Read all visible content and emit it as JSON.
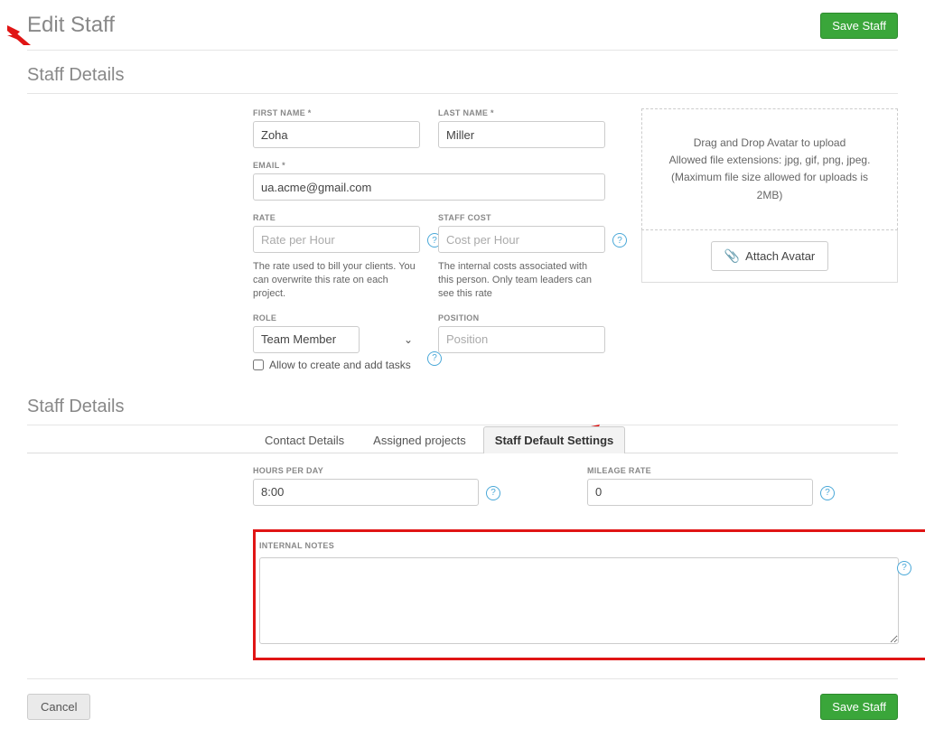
{
  "header": {
    "title": "Edit Staff",
    "save_label": "Save Staff"
  },
  "section1": {
    "title": "Staff Details",
    "first_name_label": "FIRST NAME *",
    "first_name_value": "Zoha",
    "last_name_label": "LAST NAME *",
    "last_name_value": "Miller",
    "email_label": "EMAIL *",
    "email_value": "ua.acme@gmail.com",
    "rate_label": "RATE",
    "rate_placeholder": "Rate per Hour",
    "rate_hint": "The rate used to bill your clients. You can overwrite this rate on each project.",
    "staff_cost_label": "STAFF COST",
    "staff_cost_placeholder": "Cost per Hour",
    "staff_cost_hint": "The internal costs associated with this person. Only team leaders can see this rate",
    "role_label": "ROLE",
    "role_value": "Team Member",
    "allow_tasks_label": "Allow to create and add tasks",
    "position_label": "POSITION",
    "position_placeholder": "Position"
  },
  "avatar": {
    "drop_line1": "Drag and Drop Avatar to upload",
    "drop_line2": "Allowed file extensions: jpg, gif, png, jpeg.",
    "drop_line3": "(Maximum file size allowed for uploads is 2MB)",
    "attach_label": "Attach Avatar"
  },
  "section2": {
    "title": "Staff Details",
    "tabs": {
      "contact": "Contact Details",
      "assigned": "Assigned projects",
      "defaults": "Staff Default Settings"
    },
    "hours_label": "HOURS PER DAY",
    "hours_value": "8:00",
    "mileage_label": "MILEAGE RATE",
    "mileage_value": "0",
    "notes_label": "INTERNAL NOTES"
  },
  "footer": {
    "cancel_label": "Cancel",
    "save_label": "Save Staff"
  },
  "help_glyph": "?"
}
